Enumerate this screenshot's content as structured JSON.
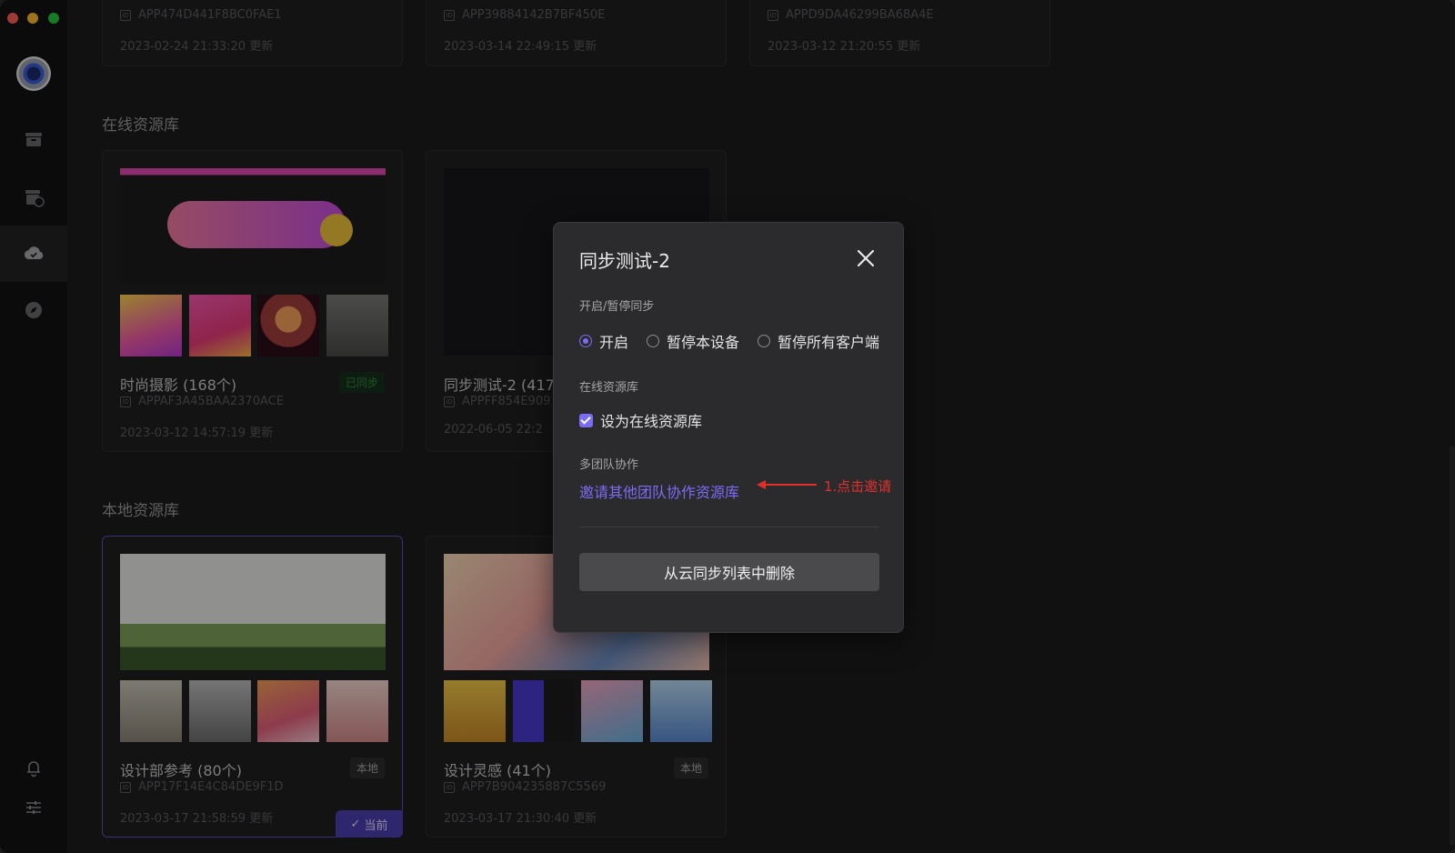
{
  "window": {
    "traffic_lights": [
      "close",
      "minimize",
      "maximize"
    ]
  },
  "sidebar": {
    "items": [
      {
        "icon": "archive-icon"
      },
      {
        "icon": "cloud-box-icon"
      },
      {
        "icon": "cloud-sync-icon",
        "active": true
      },
      {
        "icon": "compass-icon"
      }
    ],
    "bottom": [
      {
        "icon": "bell-icon"
      },
      {
        "icon": "sliders-icon"
      }
    ]
  },
  "top_cards": [
    {
      "id": "APP474D441F8BC0FAE1",
      "date": "2023-02-24 21:33:20 更新"
    },
    {
      "id": "APP39884142B7BF450E",
      "date": "2023-03-14 22:49:15 更新"
    },
    {
      "id": "APPD9DA46299BA68A4E",
      "date": "2023-03-12 21:20:55 更新"
    }
  ],
  "online": {
    "title": "在线资源库",
    "cards": [
      {
        "name": "时尚摄影 (168个)",
        "badge": "已同步",
        "id": "APPAF3A45BAA2370ACE",
        "date": "2023-03-12 14:57:19 更新"
      },
      {
        "name": "同步测试-2 (417",
        "id": "APPFF854E909",
        "date": "2022-06-05 22:2"
      }
    ]
  },
  "local": {
    "title": "本地资源库",
    "cards": [
      {
        "name": "设计部参考 (80个)",
        "badge": "本地",
        "id": "APP17F14E4C84DE9F1D",
        "date": "2023-03-17 21:58:59 更新",
        "current": "当前"
      },
      {
        "name": "设计灵感 (41个)",
        "badge": "本地",
        "id": "APP7B904235887C5569",
        "date": "2023-03-17 21:30:40 更新"
      }
    ]
  },
  "modal": {
    "title": "同步测试-2",
    "sync_label": "开启/暂停同步",
    "sync_options": [
      "开启",
      "暂停本设备",
      "暂停所有客户端"
    ],
    "sync_selected": "开启",
    "online_label": "在线资源库",
    "online_checkbox": "设为在线资源库",
    "online_checked": true,
    "team_label": "多团队协作",
    "invite_link": "邀请其他团队协作资源库",
    "delete_button": "从云同步列表中删除"
  },
  "annotation": {
    "text": "1.点击邀请",
    "color": "#e0302e"
  },
  "colors": {
    "accent": "#7b6cf6",
    "current_tag": "#4b3fb0",
    "synced": "#2e8a3e"
  }
}
